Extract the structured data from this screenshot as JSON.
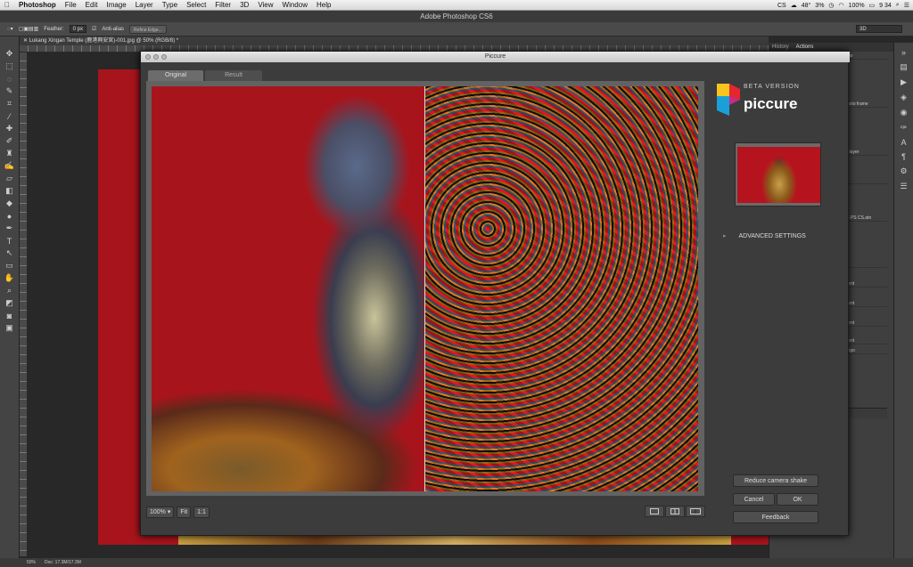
{
  "menubar": {
    "app": "Photoshop",
    "items": [
      "File",
      "Edit",
      "Image",
      "Layer",
      "Type",
      "Select",
      "Filter",
      "3D",
      "View",
      "Window",
      "Help"
    ],
    "status": {
      "cs": "CS",
      "temp": "48°",
      "pct1": "3%",
      "battery": "100%",
      "time": "9 34"
    }
  },
  "titlebar": {
    "title": "Adobe Photoshop CS6"
  },
  "options": {
    "feather_label": "Feather:",
    "feather_value": "0 px",
    "antialias": "Anti-alias",
    "refine": "Refine Edge...",
    "workspace": "3D"
  },
  "doc_tab": {
    "label": "Lukang Xingan Temple (鹿港興安宮)-001.jpg @ 50% (RGB/8) *"
  },
  "right_panel": {
    "tabs": [
      "History",
      "Actions"
    ],
    "items": [
      "logo",
      "photo frame",
      "nt layer",
      "rs",
      "_6 PS CS.atn",
      "4",
      "ment",
      "ment",
      "ment",
      "ment",
      "l logo"
    ]
  },
  "statusbar": {
    "zoom": "50%",
    "doc": "Doc: 17.3M/17.3M"
  },
  "dialog": {
    "title": "Piccure",
    "tab_original": "Original",
    "tab_result": "Result",
    "zoom_value": "100%",
    "fit_label": "Fit",
    "one_to_one": "1:1",
    "beta": "BETA VERSION",
    "logo_text": "piccure",
    "advanced": "ADVANCED SETTINGS",
    "advanced_arrow": "▸",
    "reduce_shake": "Reduce camera shake",
    "cancel": "Cancel",
    "ok": "OK",
    "feedback": "Feedback"
  },
  "colors": {
    "logo_yellow": "#f7c51e",
    "logo_red": "#e5262e",
    "logo_blue": "#1aa0d8",
    "logo_pink": "#c62a8a",
    "image_red": "#a8141c"
  }
}
